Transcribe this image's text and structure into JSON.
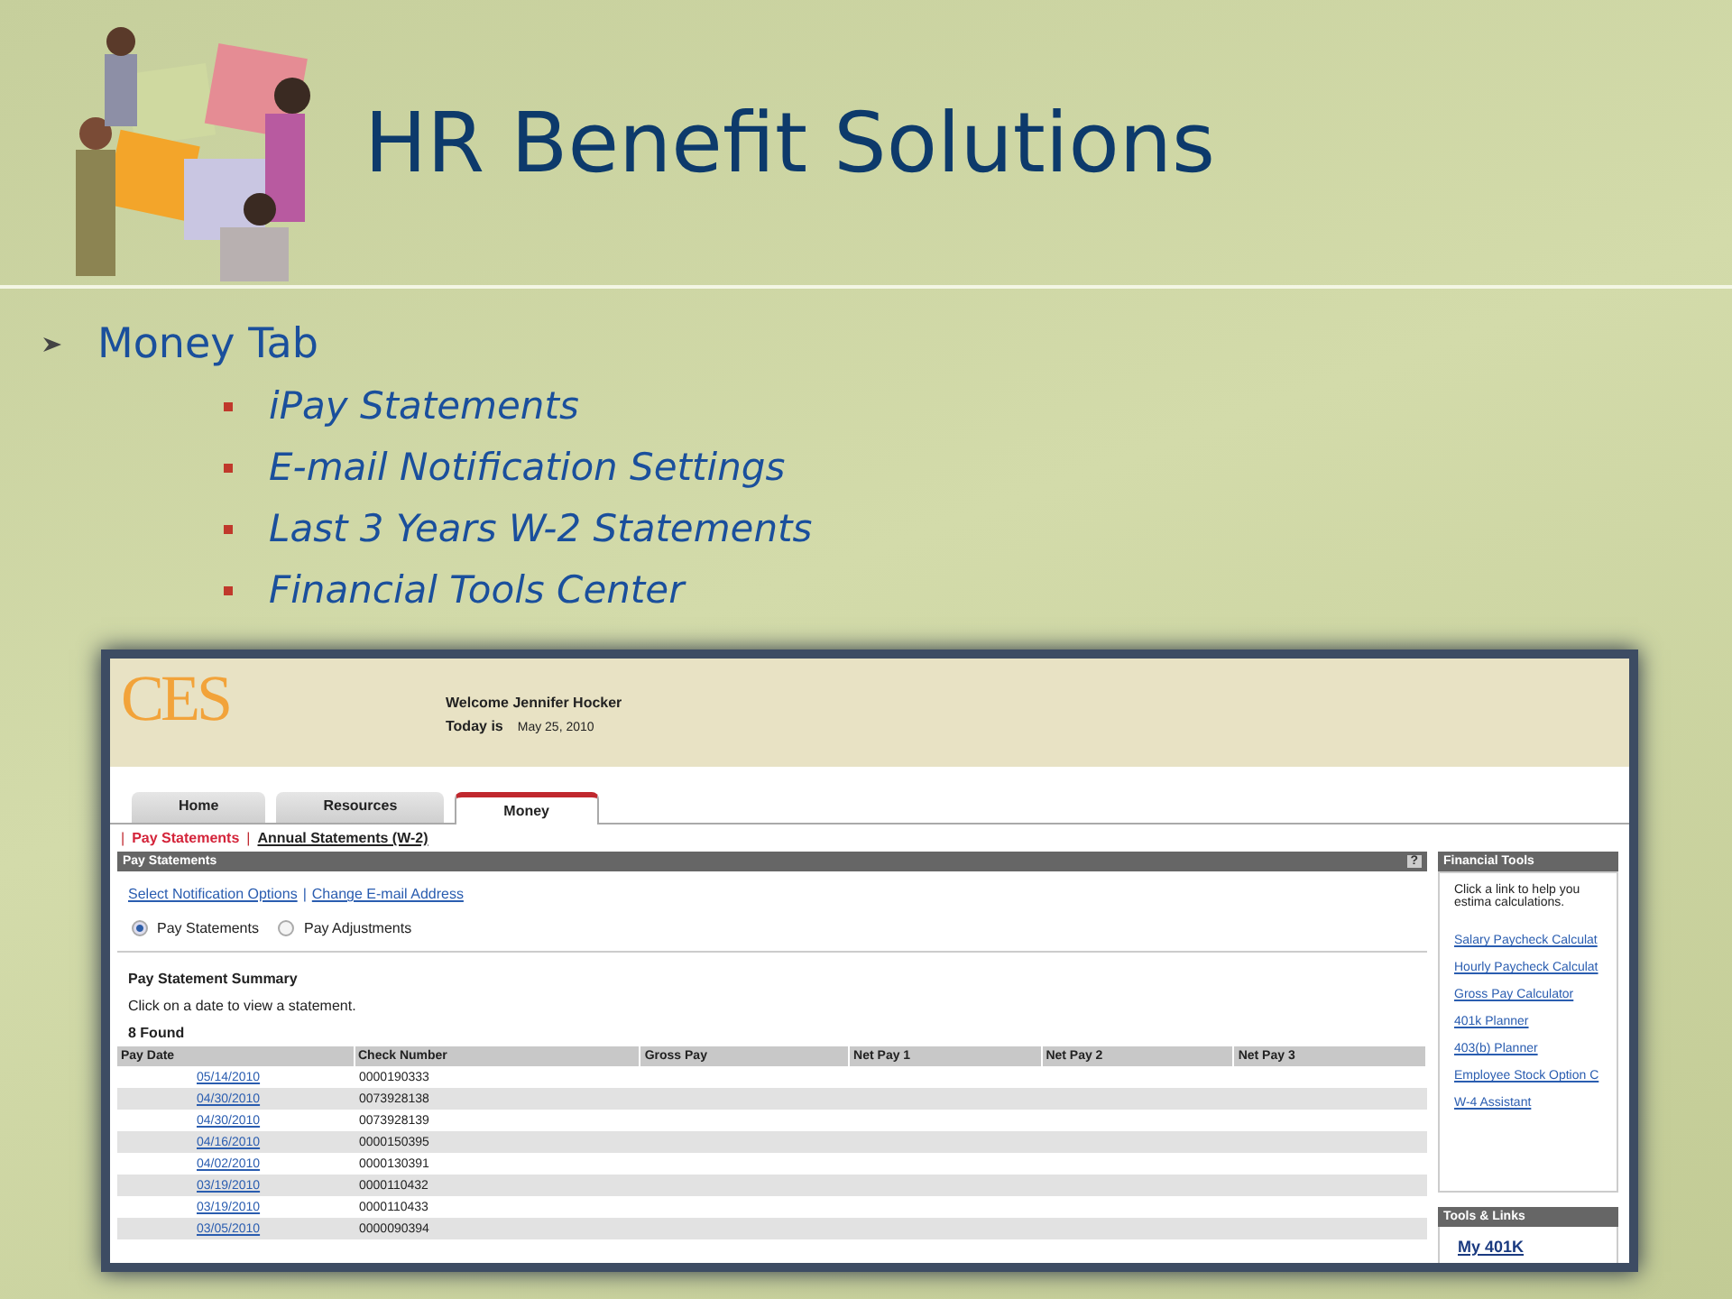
{
  "slide": {
    "title": "HR Benefit Solutions",
    "bullets": [
      {
        "text": "Money Tab",
        "children": [
          {
            "text": "iPay Statements"
          },
          {
            "text": "E-mail Notification Settings"
          },
          {
            "text": "Last 3 Years W-2 Statements"
          },
          {
            "text": "Financial Tools Center"
          }
        ]
      }
    ]
  },
  "screen": {
    "header": {
      "logo": "CES",
      "welcome": "Welcome Jennifer Hocker",
      "today_label": "Today is",
      "today_value": "May 25, 2010"
    },
    "tabs": [
      {
        "label": "Home",
        "selected": false
      },
      {
        "label": "Resources",
        "selected": false
      },
      {
        "label": "Money",
        "selected": true
      }
    ],
    "separator": "|",
    "subnav": [
      {
        "label": "Pay Statements",
        "selected": true
      },
      {
        "label": "Annual Statements (W-2)",
        "selected": false
      }
    ],
    "panel": {
      "title": "Pay Statements",
      "help": "?",
      "links": [
        "Select Notification Options",
        "Change E-mail Address"
      ],
      "radios": [
        {
          "label": "Pay Statements",
          "selected": true
        },
        {
          "label": "Pay Adjustments",
          "selected": false
        }
      ],
      "summary_title": "Pay Statement Summary",
      "summary_note": "Click on a date to view a statement.",
      "found": "8  Found",
      "table": {
        "columns": [
          "Pay Date",
          "Check Number",
          "Gross Pay",
          "Net Pay 1",
          "Net Pay 2",
          "Net Pay 3"
        ],
        "rows": [
          {
            "pay_date": "05/14/2010",
            "check_number": "0000190333"
          },
          {
            "pay_date": "04/30/2010",
            "check_number": "0073928138"
          },
          {
            "pay_date": "04/30/2010",
            "check_number": "0073928139"
          },
          {
            "pay_date": "04/16/2010",
            "check_number": "0000150395"
          },
          {
            "pay_date": "04/02/2010",
            "check_number": "0000130391"
          },
          {
            "pay_date": "03/19/2010",
            "check_number": "0000110432"
          },
          {
            "pay_date": "03/19/2010",
            "check_number": "0000110433"
          },
          {
            "pay_date": "03/05/2010",
            "check_number": "0000090394"
          }
        ]
      }
    },
    "sidebar": {
      "financial_tools": {
        "title": "Financial Tools",
        "note": "Click a link to help you estima calculations.",
        "links": [
          "Salary Paycheck Calculat",
          "Hourly Paycheck Calculat",
          "Gross Pay Calculator",
          "401k Planner",
          "403(b) Planner",
          "Employee Stock Option C",
          "W-4 Assistant"
        ]
      },
      "tools_links": {
        "title": "Tools & Links",
        "links": [
          "My 401K"
        ]
      }
    }
  }
}
